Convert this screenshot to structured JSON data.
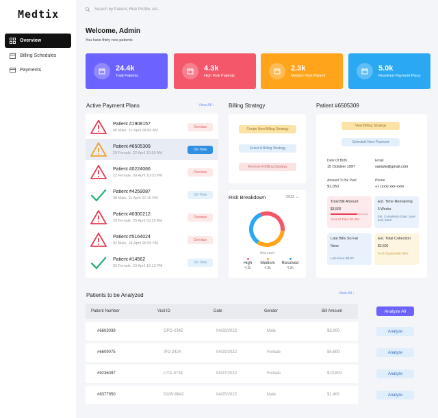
{
  "app": {
    "logo": "Medtix"
  },
  "sidebar": {
    "items": [
      {
        "label": "Overview"
      },
      {
        "label": "Billing Schedules"
      },
      {
        "label": "Payments"
      }
    ]
  },
  "search": {
    "placeholder": "Search by Patient, Risk Profile, etc.."
  },
  "header": {
    "welcome": "Welcome, Admin",
    "subtitle": "You have thirty new patients"
  },
  "stats": [
    {
      "value": "24.4k",
      "label": "Total Patients",
      "color": "#6c63ff"
    },
    {
      "value": "4.3k",
      "label": "High Risk Patients",
      "color": "#f4566a"
    },
    {
      "value": "2.3k",
      "label": "Medium Risk Patient",
      "color": "#ffa41b"
    },
    {
      "value": "5.0k",
      "label": "Resolved Payment Plans",
      "color": "#2aa8f2"
    }
  ],
  "plans": {
    "title": "Active Payment Plans",
    "view_all": "View All",
    "rows": [
      {
        "id": "Patient #1908157",
        "desc": "45 Male, 12 April 09:06 AM",
        "status": "Overdue",
        "icon": "warning-red-icon"
      },
      {
        "id": "Patient #6505309",
        "desc": "29 Female, 22 April 10:55 AM",
        "status": "On-Time",
        "icon": "warning-orange-icon"
      },
      {
        "id": "Patient #0224066",
        "desc": "22 Female, 09 April 10:03 PM",
        "status": "Overdue",
        "icon": "warning-red-icon"
      },
      {
        "id": "Patient #4259087",
        "desc": "38 Male, 11 April 02:10 PM",
        "status": "On-Time",
        "icon": "check-icon"
      },
      {
        "id": "Patient #0300212",
        "desc": "29 Female, 25 April 03:25 AM",
        "status": "Overdue",
        "icon": "warning-red-icon"
      },
      {
        "id": "Patient #5164024",
        "desc": "82 Male, 24 April 06:05 PM",
        "status": "Overdue",
        "icon": "warning-red-icon"
      },
      {
        "id": "Patient #14562",
        "desc": "53 Female, 23 April 12:13 PM",
        "status": "On-Time",
        "icon": "check-icon"
      }
    ]
  },
  "billing": {
    "title": "Billing Strategy",
    "create": "Create New Billing Strategy",
    "select": "Select A Billing Strategy",
    "remove": "Remove A Billing Strategy"
  },
  "risk": {
    "title": "Risk Breakdown",
    "year": "2022",
    "level_label": "Risk Level",
    "legend": [
      {
        "name": "High",
        "value": "4.3k",
        "color": "#f4566a"
      },
      {
        "name": "Medium",
        "value": "4.3k",
        "color": "#ffa41b"
      },
      {
        "name": "Resolved",
        "value": "4.3k",
        "color": "#2aa8f2"
      }
    ],
    "donut": [
      {
        "name": "High",
        "fraction": 0.33,
        "color": "#f4566a"
      },
      {
        "name": "Medium",
        "fraction": 0.33,
        "color": "#ffa41b"
      },
      {
        "name": "Resolved",
        "fraction": 0.34,
        "color": "#2aa8f2"
      }
    ]
  },
  "patient": {
    "title": "Patient #6505309",
    "view_billing": "View Billing Strategy",
    "schedule": "Schedule Next Payment",
    "dob_label": "Date Of Birth",
    "dob": "15 October 1997",
    "email_label": "Email",
    "email": "sample@gmail.com",
    "amount_label": "Amount To Be Paid",
    "amount": "$1,050",
    "phone_label": "Phone",
    "phone": "+1 (xxx) xxx-xxxx",
    "total_bill": {
      "title": "Total Bill Amount",
      "value": "$3,500",
      "foot": "Amount Paid: $2,450",
      "progress": 0.7
    },
    "est_time": {
      "title": "Est. Time Remaining",
      "value": "5 Weeks",
      "foot": "Est. Completion Date: June 2nd, 2023"
    },
    "late_bills": {
      "title": "Late Bills So Far",
      "value": "None",
      "foot": "Late Fees: $0.00"
    },
    "est_collection": {
      "title": "Est. Total Collection",
      "value": "$3,500",
      "foot": "% of Original Bill: 88%"
    }
  },
  "analyze": {
    "title": "Patients to be Analyzed",
    "view_all": "View All",
    "analyze_all": "Analyze All",
    "headers": [
      "Patient Number",
      "Visit ID",
      "Date",
      "Gender",
      "Bill Amount"
    ],
    "rows": [
      {
        "num": "#6603039",
        "visit": "OPD-2345",
        "date": "04/28/2022",
        "gender": "Male",
        "bill": "$3,000",
        "action": "Analyze"
      },
      {
        "num": "#6609075",
        "visit": "IPD-2424",
        "date": "04/29/2022",
        "gender": "Female",
        "bill": "$5,600",
        "action": "Analyze"
      },
      {
        "num": "#9236097",
        "visit": "UYD-8734",
        "date": "04/27/2022",
        "gender": "Female",
        "bill": "$10,800",
        "action": "Analyze"
      },
      {
        "num": "#8377950",
        "visit": "DUW-9842",
        "date": "04/25/2022",
        "gender": "Male",
        "bill": "$1,400",
        "action": "Analyze"
      }
    ]
  }
}
